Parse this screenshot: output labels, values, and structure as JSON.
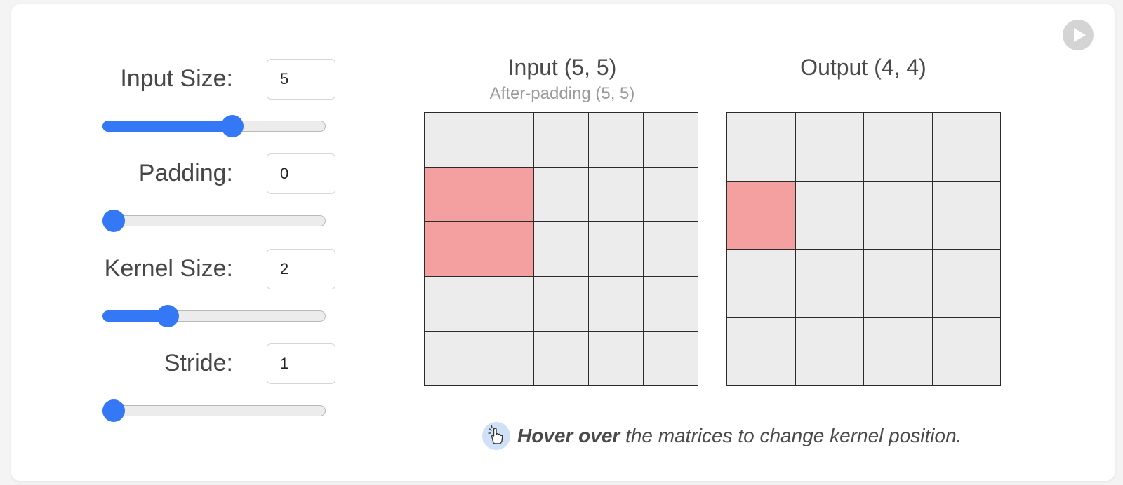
{
  "controls": [
    {
      "label": "Input Size:",
      "value": "5",
      "slider_fraction": 0.59
    },
    {
      "label": "Padding:",
      "value": "0",
      "slider_fraction": 0.0
    },
    {
      "label": "Kernel Size:",
      "value": "2",
      "slider_fraction": 0.27
    },
    {
      "label": "Stride:",
      "value": "1",
      "slider_fraction": 0.0
    }
  ],
  "input_matrix": {
    "title": "Input (5, 5)",
    "subtitle": "After-padding (5, 5)",
    "rows": 5,
    "cols": 5,
    "highlighted": [
      [
        1,
        0
      ],
      [
        1,
        1
      ],
      [
        2,
        0
      ],
      [
        2,
        1
      ]
    ]
  },
  "output_matrix": {
    "title": "Output (4, 4)",
    "rows": 4,
    "cols": 4,
    "highlighted": [
      [
        1,
        0
      ]
    ]
  },
  "hint": {
    "bold": "Hover over",
    "rest": " the matrices to change kernel position."
  },
  "icons": {
    "play": "play-icon",
    "hint": "hand-pointer-icon"
  },
  "colors": {
    "accent": "#3478f6",
    "highlight": "#f4a0a1",
    "cell": "#ececec"
  }
}
